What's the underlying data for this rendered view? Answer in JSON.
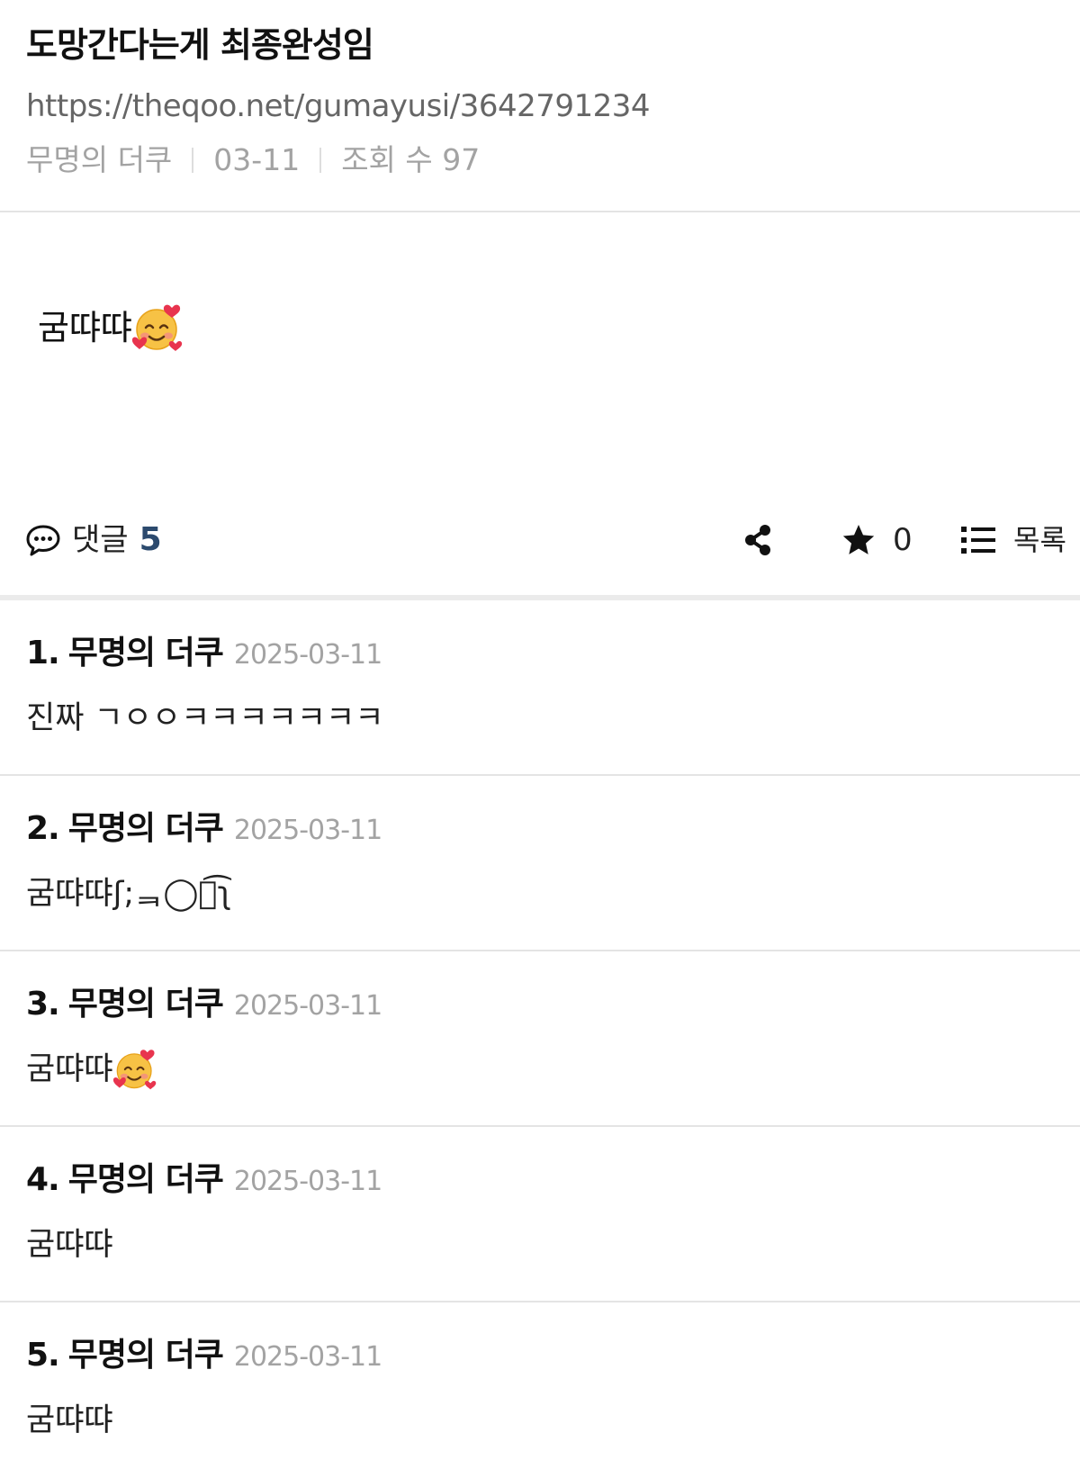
{
  "post": {
    "title": "도망간다는게 최종완성임",
    "url": "https://theqoo.net/gumayusi/3642791234",
    "author": "무명의 더쿠",
    "date": "03-11",
    "views": "조회 수 97",
    "body_text": "굼땨땨",
    "body_emoji": "smiling-face-with-hearts-icon"
  },
  "actions": {
    "comment_label": "댓글",
    "comment_count": "5",
    "star_count": "0",
    "list_label": "목록",
    "icons": [
      "speech-bubble-icon",
      "share-icon",
      "star-icon",
      "list-icon"
    ]
  },
  "comments": [
    {
      "num": "1.",
      "author": "무명의 더쿠",
      "date": "2025-03-11",
      "text": "진짜 ㄱㅇㅇㅋㅋㅋㅋㅋㅋㅋ"
    },
    {
      "num": "2.",
      "author": "무명의 더쿠",
      "date": "2025-03-11",
      "text": "굼땨땨ʃ;ᆿ◯ᆿ͡ʅ"
    },
    {
      "num": "3.",
      "author": "무명의 더쿠",
      "date": "2025-03-11",
      "text": "굼땨땨",
      "emoji": "smiling-face-with-hearts-icon"
    },
    {
      "num": "4.",
      "author": "무명의 더쿠",
      "date": "2025-03-11",
      "text": "굼땨땨"
    },
    {
      "num": "5.",
      "author": "무명의 더쿠",
      "date": "2025-03-11",
      "text": "굼땨땨"
    }
  ],
  "colors": {
    "accent_count": "#2c4a6e",
    "meta_gray": "#a3a3a3",
    "divider": "#e4e4e4"
  }
}
